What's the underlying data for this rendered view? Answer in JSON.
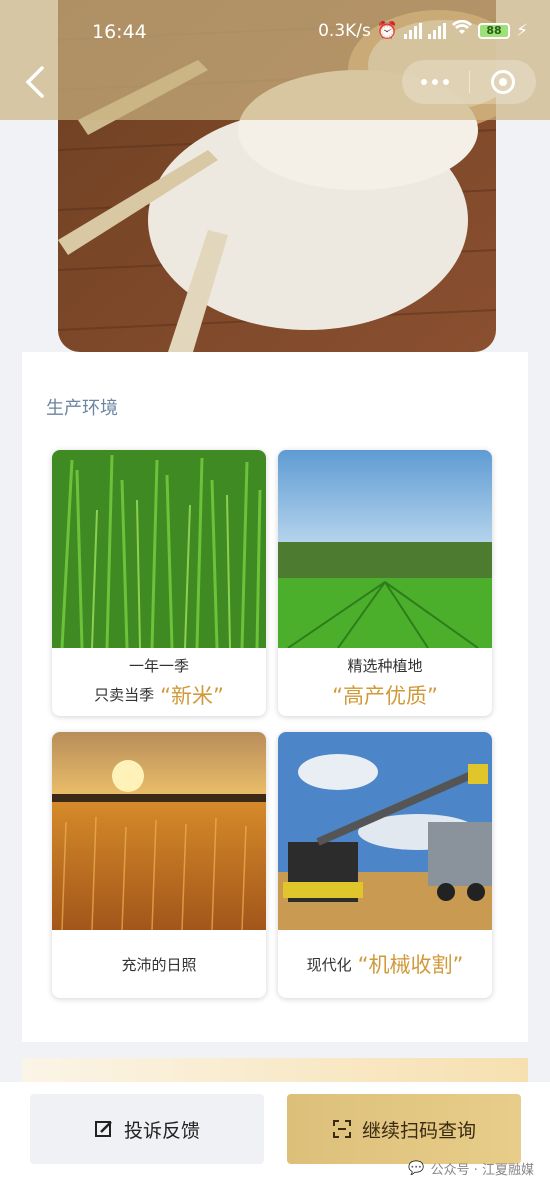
{
  "status_bar": {
    "time": "16:44",
    "net_speed": "0.3K/s",
    "battery": "88"
  },
  "nav": {
    "back_icon": "chevron-left-icon",
    "menu_icon": "more-dots-icon",
    "close_icon": "target-icon"
  },
  "section": {
    "title": "生产环境"
  },
  "tiles": [
    {
      "line1": "一年一季",
      "line2_prefix": "只卖当季",
      "highlight": "“新米”"
    },
    {
      "line1": "精选种植地",
      "highlight": "“高产优质”"
    },
    {
      "caption": "充沛的日照"
    },
    {
      "prefix": "现代化",
      "highlight": "“机械收割”"
    }
  ],
  "actions": {
    "feedback_label": "投诉反馈",
    "scan_label": "继续扫码查询"
  },
  "watermark": {
    "text": "公众号 · 江夏融媒"
  },
  "colors": {
    "accent_gold": "#d09a3a",
    "section_title": "#6b86a0",
    "scan_button": "#e0c47e"
  }
}
